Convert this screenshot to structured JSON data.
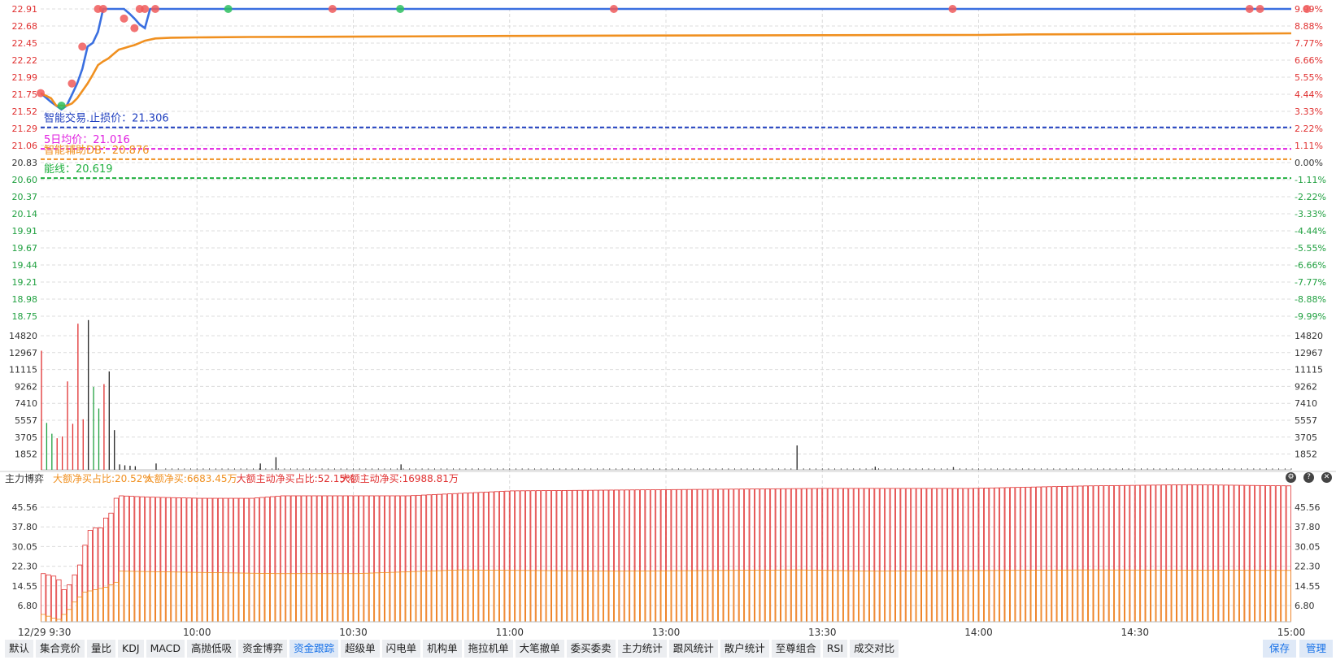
{
  "chart_data": [
    {
      "type": "line",
      "name": "price-panel",
      "y_left_ticks": [
        "22.91",
        "22.68",
        "22.45",
        "22.22",
        "21.99",
        "21.75",
        "21.52",
        "21.29",
        "21.06",
        "20.83",
        "20.60",
        "20.37",
        "20.14",
        "19.91",
        "19.67",
        "19.44",
        "19.21",
        "18.98",
        "18.75"
      ],
      "y_right_ticks": [
        "9.99%",
        "8.88%",
        "7.77%",
        "6.66%",
        "5.55%",
        "4.44%",
        "3.33%",
        "2.22%",
        "1.11%",
        "0.00%",
        "-1.11%",
        "-2.22%",
        "-3.33%",
        "-4.44%",
        "-5.55%",
        "-6.66%",
        "-7.77%",
        "-8.88%",
        "-9.99%"
      ],
      "ylim": [
        18.75,
        22.91
      ],
      "xlim": [
        0,
        240
      ],
      "series": [
        {
          "color": "#3a6fe0",
          "points": [
            [
              0,
              21.77
            ],
            [
              2,
              21.65
            ],
            [
              4,
              21.55
            ],
            [
              5,
              21.6
            ],
            [
              6,
              21.75
            ],
            [
              7,
              21.9
            ],
            [
              8,
              22.1
            ],
            [
              9,
              22.4
            ],
            [
              10,
              22.45
            ],
            [
              11,
              22.6
            ],
            [
              12,
              22.91
            ],
            [
              13,
              22.91
            ],
            [
              14,
              22.91
            ],
            [
              15,
              22.91
            ],
            [
              16,
              22.91
            ],
            [
              17,
              22.85
            ],
            [
              18,
              22.78
            ],
            [
              19,
              22.7
            ],
            [
              20,
              22.65
            ],
            [
              21,
              22.91
            ],
            [
              22,
              22.91
            ],
            [
              240,
              22.91
            ]
          ]
        },
        {
          "color": "#f09020",
          "points": [
            [
              0,
              21.77
            ],
            [
              2,
              21.7
            ],
            [
              3,
              21.6
            ],
            [
              5,
              21.6
            ],
            [
              6,
              21.63
            ],
            [
              7,
              21.7
            ],
            [
              8,
              21.8
            ],
            [
              9,
              21.9
            ],
            [
              10,
              22.02
            ],
            [
              11,
              22.15
            ],
            [
              12,
              22.2
            ],
            [
              13,
              22.24
            ],
            [
              14,
              22.3
            ],
            [
              15,
              22.36
            ],
            [
              16,
              22.38
            ],
            [
              17,
              22.4
            ],
            [
              18,
              22.42
            ],
            [
              19,
              22.45
            ],
            [
              20,
              22.48
            ],
            [
              22,
              22.51
            ],
            [
              25,
              22.52
            ],
            [
              30,
              22.525
            ],
            [
              40,
              22.53
            ],
            [
              60,
              22.535
            ],
            [
              90,
              22.545
            ],
            [
              120,
              22.55
            ],
            [
              150,
              22.555
            ],
            [
              180,
              22.558
            ],
            [
              190,
              22.565
            ],
            [
              210,
              22.57
            ],
            [
              240,
              22.58
            ]
          ]
        }
      ],
      "markers": [
        {
          "x": 0,
          "y": 21.77,
          "color": "#f05a5a"
        },
        {
          "x": 4,
          "y": 21.6,
          "color": "#2ec060"
        },
        {
          "x": 6,
          "y": 21.9,
          "color": "#f05a5a"
        },
        {
          "x": 8,
          "y": 22.4,
          "color": "#f05a5a"
        },
        {
          "x": 11,
          "y": 22.91,
          "color": "#f05a5a"
        },
        {
          "x": 12,
          "y": 22.91,
          "color": "#f05a5a"
        },
        {
          "x": 16,
          "y": 22.78,
          "color": "#f05a5a"
        },
        {
          "x": 18,
          "y": 22.65,
          "color": "#f05a5a"
        },
        {
          "x": 19,
          "y": 22.91,
          "color": "#f05a5a"
        },
        {
          "x": 20,
          "y": 22.91,
          "color": "#f05a5a"
        },
        {
          "x": 22,
          "y": 22.91,
          "color": "#f05a5a"
        },
        {
          "x": 36,
          "y": 22.91,
          "color": "#2ec060"
        },
        {
          "x": 56,
          "y": 22.91,
          "color": "#f05a5a"
        },
        {
          "x": 69,
          "y": 22.91,
          "color": "#2ec060"
        },
        {
          "x": 110,
          "y": 22.91,
          "color": "#f05a5a"
        },
        {
          "x": 175,
          "y": 22.91,
          "color": "#f05a5a"
        },
        {
          "x": 232,
          "y": 22.91,
          "color": "#f05a5a"
        },
        {
          "x": 234,
          "y": 22.91,
          "color": "#f05a5a"
        },
        {
          "x": 243,
          "y": 22.91,
          "color": "#f05a5a"
        }
      ],
      "hlines": [
        {
          "label": "智能交易.止损价：21.306",
          "value": 21.306,
          "color": "#1f3fbf"
        },
        {
          "label": "5日均价：21.016",
          "value": 21.016,
          "color": "#e020e0"
        },
        {
          "label": "智能辅助DB：20.876",
          "value": 20.876,
          "color": "#f09020"
        },
        {
          "label": "能线：20.619",
          "value": 20.619,
          "color": "#20b040"
        }
      ]
    },
    {
      "type": "bar",
      "name": "volume-panel",
      "y_ticks": [
        "14820",
        "12967",
        "11115",
        "9262",
        "7410",
        "5557",
        "3705",
        "1852"
      ],
      "ylim": [
        0,
        16670
      ],
      "bars": [
        {
          "x": 0,
          "v": 13200,
          "c": "#e03030"
        },
        {
          "x": 1,
          "v": 5200,
          "c": "#20a040"
        },
        {
          "x": 2,
          "v": 4000,
          "c": "#20a040"
        },
        {
          "x": 3,
          "v": 3500,
          "c": "#e03030"
        },
        {
          "x": 4,
          "v": 3700,
          "c": "#e03030"
        },
        {
          "x": 5,
          "v": 9800,
          "c": "#e03030"
        },
        {
          "x": 6,
          "v": 5100,
          "c": "#e03030"
        },
        {
          "x": 7,
          "v": 16200,
          "c": "#e03030"
        },
        {
          "x": 8,
          "v": 5600,
          "c": "#e03030"
        },
        {
          "x": 9,
          "v": 16600,
          "c": "#222222"
        },
        {
          "x": 10,
          "v": 9200,
          "c": "#20a040"
        },
        {
          "x": 11,
          "v": 6800,
          "c": "#20a040"
        },
        {
          "x": 12,
          "v": 9500,
          "c": "#e03030"
        },
        {
          "x": 13,
          "v": 10900,
          "c": "#222222"
        },
        {
          "x": 14,
          "v": 4400,
          "c": "#222222"
        },
        {
          "x": 15,
          "v": 600,
          "c": "#222222"
        },
        {
          "x": 16,
          "v": 500,
          "c": "#222222"
        },
        {
          "x": 17,
          "v": 450,
          "c": "#222222"
        },
        {
          "x": 18,
          "v": 400,
          "c": "#222222"
        },
        {
          "x": 22,
          "v": 700,
          "c": "#222222"
        },
        {
          "x": 45,
          "v": 1400,
          "c": "#222222"
        },
        {
          "x": 42,
          "v": 700,
          "c": "#222222"
        },
        {
          "x": 69,
          "v": 600,
          "c": "#222222"
        },
        {
          "x": 145,
          "v": 2700,
          "c": "#222222"
        },
        {
          "x": 160,
          "v": 350,
          "c": "#222222"
        },
        {
          "x": 175,
          "v": 300,
          "c": "#222222"
        }
      ]
    },
    {
      "type": "bar",
      "name": "fund-flow-panel",
      "title": "主力博弈",
      "indicators": [
        {
          "text": "大额净买占比:20.52%",
          "color": "#f09020"
        },
        {
          "text": "大额净买:6683.45万",
          "color": "#f09020"
        },
        {
          "text": "大额主动净买占比:52.15%",
          "color": "#e03030"
        },
        {
          "text": "大额主动净买:16988.81万",
          "color": "#e03030"
        }
      ],
      "y_ticks": [
        "45.56",
        "37.80",
        "30.05",
        "22.30",
        "14.55",
        "6.80"
      ],
      "ylim": [
        0,
        53.3
      ],
      "red_series": [
        [
          0,
          19.5
        ],
        [
          2,
          18.5
        ],
        [
          3,
          17
        ],
        [
          4,
          13
        ],
        [
          5,
          15
        ],
        [
          7,
          23
        ],
        [
          8,
          31
        ],
        [
          9,
          37
        ],
        [
          10,
          38
        ],
        [
          11,
          38
        ],
        [
          12,
          42
        ],
        [
          13,
          44
        ],
        [
          14,
          50
        ],
        [
          15,
          51
        ],
        [
          20,
          50.5
        ],
        [
          30,
          50
        ],
        [
          40,
          50
        ],
        [
          46,
          51
        ],
        [
          70,
          51
        ],
        [
          90,
          53
        ],
        [
          120,
          53.5
        ],
        [
          150,
          54
        ],
        [
          175,
          54
        ],
        [
          178,
          54
        ],
        [
          200,
          55
        ],
        [
          220,
          55.5
        ],
        [
          240,
          55
        ]
      ],
      "orange_series": [
        [
          0,
          3
        ],
        [
          2,
          1.5
        ],
        [
          3,
          1
        ],
        [
          4,
          3
        ],
        [
          5,
          5
        ],
        [
          6,
          8
        ],
        [
          7,
          10
        ],
        [
          8,
          12
        ],
        [
          10,
          13
        ],
        [
          12,
          14
        ],
        [
          14,
          16
        ],
        [
          15,
          20.5
        ],
        [
          30,
          20
        ],
        [
          45,
          19.5
        ],
        [
          60,
          19.5
        ],
        [
          80,
          21
        ],
        [
          110,
          20.5
        ],
        [
          145,
          21
        ],
        [
          160,
          20.5
        ],
        [
          200,
          21
        ],
        [
          240,
          20.8
        ]
      ]
    }
  ],
  "x_axis": {
    "labels": [
      {
        "t": "12/29 9:30",
        "x": 0
      },
      {
        "t": "10:00",
        "x": 30
      },
      {
        "t": "10:30",
        "x": 60
      },
      {
        "t": "11:00",
        "x": 90
      },
      {
        "t": "13:00",
        "x": 120
      },
      {
        "t": "13:30",
        "x": 150
      },
      {
        "t": "14:00",
        "x": 180
      },
      {
        "t": "14:30",
        "x": 210
      },
      {
        "t": "15:00",
        "x": 240
      }
    ]
  },
  "tabs": [
    "默认",
    "集合竞价",
    "量比",
    "KDJ",
    "MACD",
    "高抛低吸",
    "资金博弈",
    "资金跟踪",
    "超级单",
    "闪电单",
    "机构单",
    "拖拉机单",
    "大笔撤单",
    "委买委卖",
    "主力统计",
    "跟风统计",
    "散户统计",
    "至尊组合",
    "RSI",
    "成交对比"
  ],
  "active_tab": "资金跟踪",
  "right_buttons": [
    "保存",
    "管理"
  ],
  "panel_controls": [
    "gear-icon",
    "help-icon",
    "close-icon"
  ]
}
